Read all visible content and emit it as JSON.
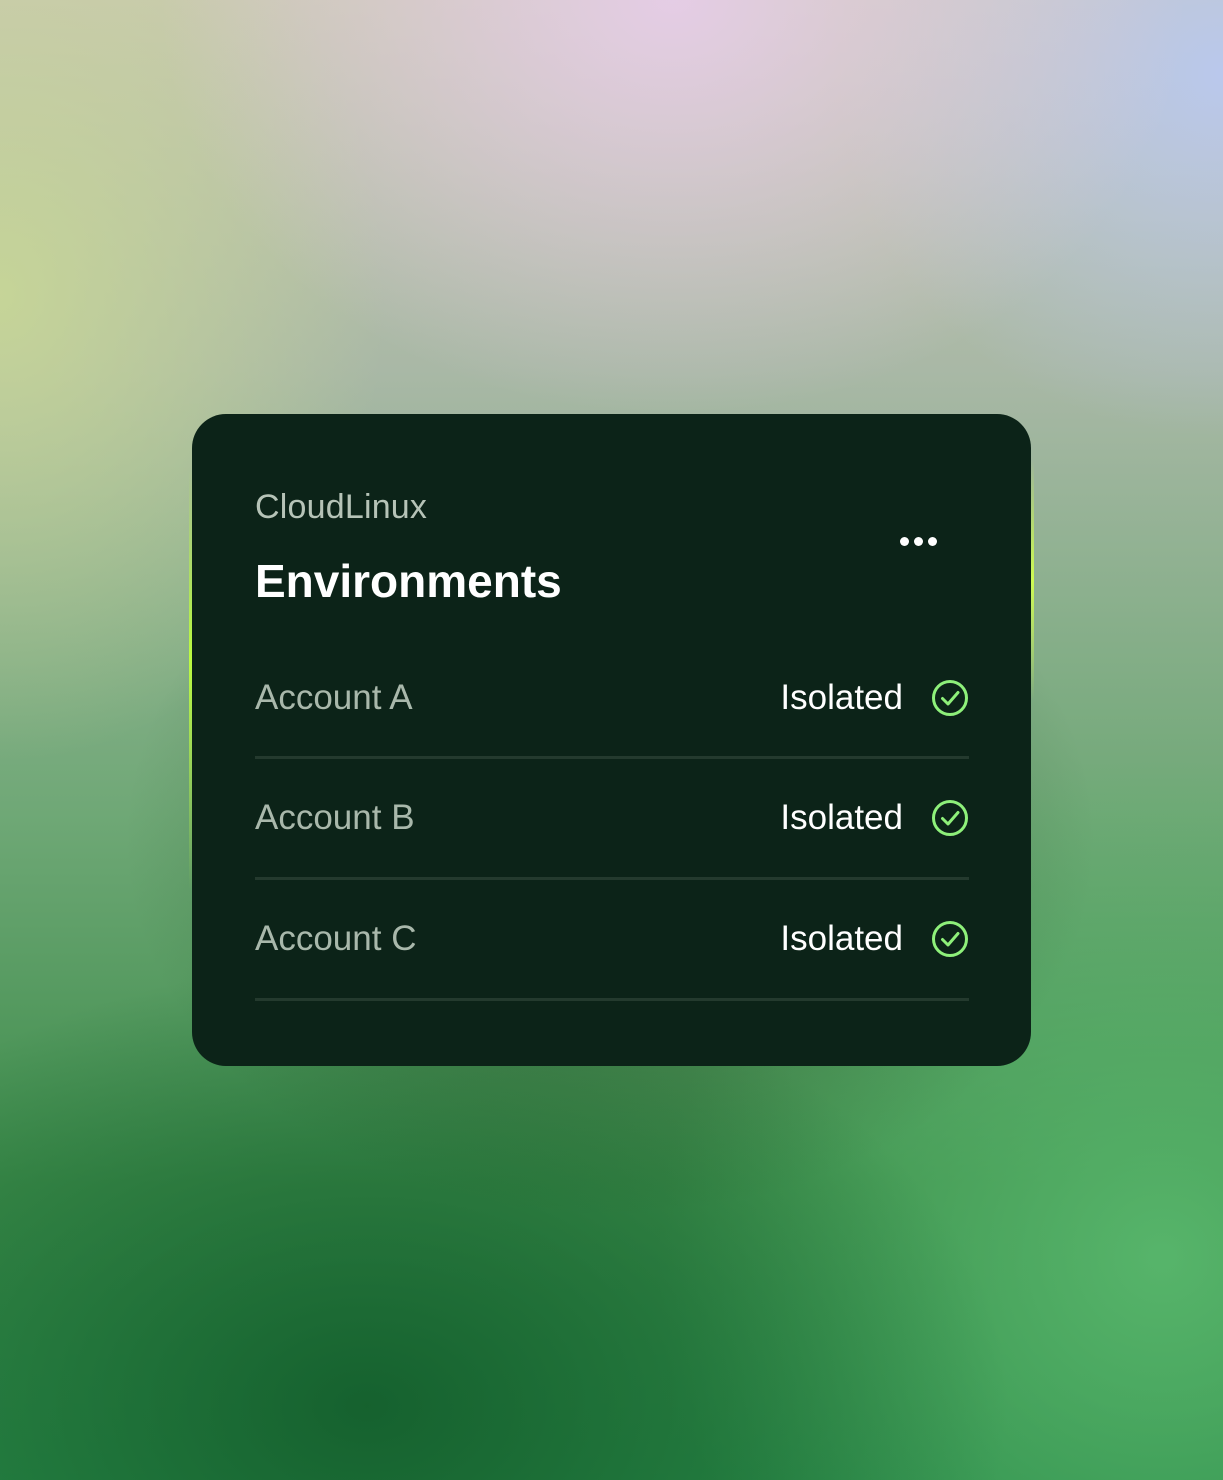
{
  "card": {
    "brand": "CloudLinux",
    "title": "Environments",
    "menu_icon": "more-horizontal-icon",
    "rows": [
      {
        "account": "Account A",
        "status": "Isolated",
        "status_icon": "check-circle-icon"
      },
      {
        "account": "Account B",
        "status": "Isolated",
        "status_icon": "check-circle-icon"
      },
      {
        "account": "Account C",
        "status": "Isolated",
        "status_icon": "check-circle-icon"
      }
    ]
  },
  "colors": {
    "card_background": "#0c2318",
    "accent_check": "#8ef07a",
    "divider": "#243a2e"
  }
}
